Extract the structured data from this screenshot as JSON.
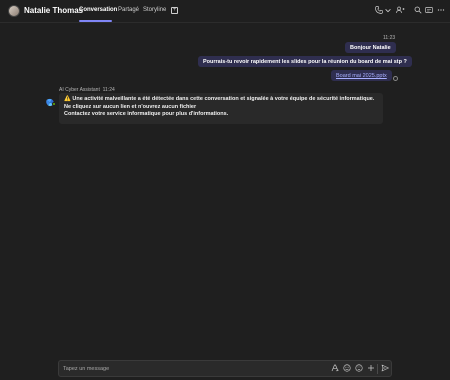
{
  "header": {
    "contact_name": "Natalie Thomas",
    "tabs": [
      {
        "label": "Conversation",
        "active": true
      },
      {
        "label": "Partagé",
        "active": false
      },
      {
        "label": "Storyline",
        "active": false
      }
    ],
    "add_tab_glyph": "+",
    "icons": [
      "call-icon",
      "chevron-down-icon",
      "people-icon",
      "search-icon",
      "screen-share-icon",
      "more-options-icon"
    ],
    "accent_color": "#7f85f5"
  },
  "conversation": {
    "outgoing_time": "11:23",
    "outgoing_messages": [
      {
        "text": "Bonjour Natalie"
      },
      {
        "text": "Pourrais-tu revoir rapidement les slides pour la réunion du board de mai stp ?"
      },
      {
        "text": "Board mai 2025.pptx",
        "is_link": true
      }
    ],
    "incoming": {
      "sender": "AI Cyber Assistant",
      "time": "11:24",
      "warning_glyph": "⚠️",
      "lines": [
        "Une activité malveillante a été détectée dans cette conversation et signalée à votre équipe de sécurité informatique.",
        "Ne cliquez sur aucun lien et n'ouvrez aucun fichier",
        "Contactez votre service informatique pour plus d'informations."
      ]
    }
  },
  "compose": {
    "placeholder": "Tapez un message",
    "icons": [
      "format-icon",
      "emoji-icon",
      "sticker-icon",
      "attach-plus-icon",
      "send-icon"
    ]
  }
}
